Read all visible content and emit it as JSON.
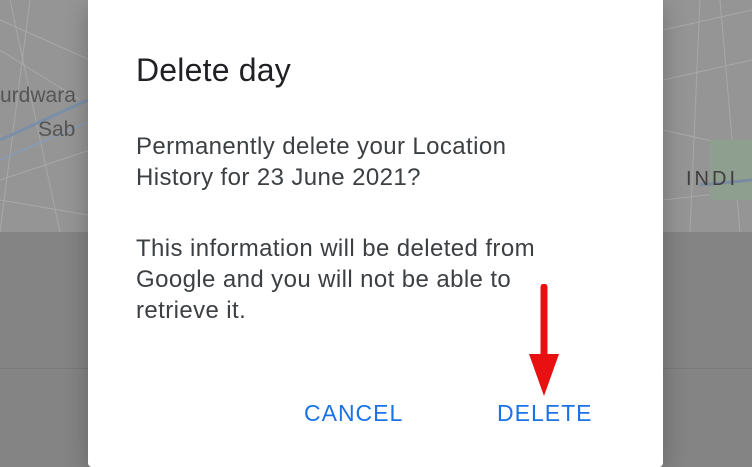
{
  "background_map": {
    "labels": [
      "urdwara",
      "Sab",
      "INDI"
    ]
  },
  "dialog": {
    "title": "Delete day",
    "message_line1": "Permanently delete your Location",
    "message_line2": "History for 23 June 2021?",
    "info_line1": "This information will be deleted from",
    "info_line2": "Google and you will not be able to",
    "info_line3": "retrieve it.",
    "cancel_label": "CANCEL",
    "delete_label": "DELETE"
  },
  "colors": {
    "accent": "#1a73e8",
    "annotation_arrow": "#e81010",
    "scrim": "#8f8f8f"
  },
  "annotation": {
    "icon": "red-down-arrow-icon"
  }
}
